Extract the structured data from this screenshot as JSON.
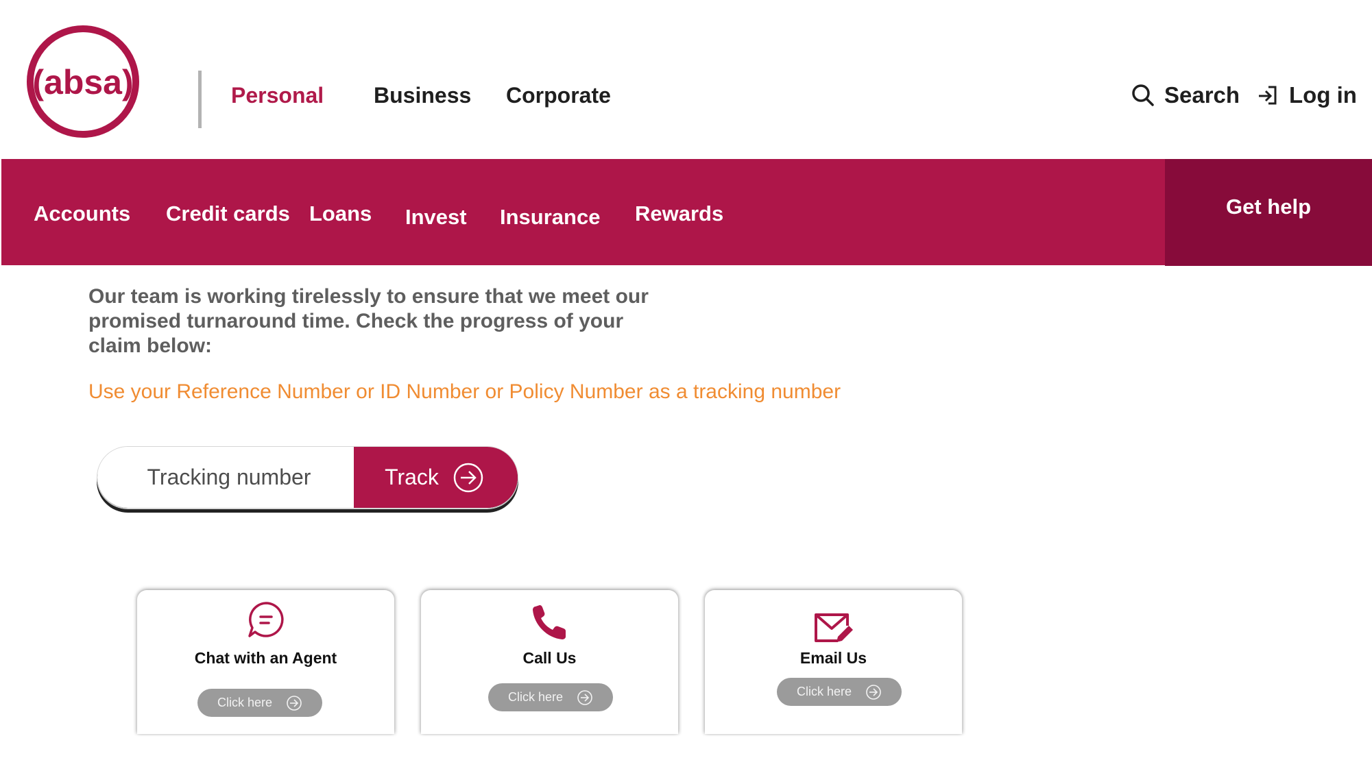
{
  "brand": {
    "logo_text": "absa",
    "accent": "#ae1649",
    "accent_dark": "#870b3a",
    "hint_color": "#f08c32"
  },
  "segments": [
    "Personal",
    "Business",
    "Corporate"
  ],
  "utility": {
    "search_label": "Search",
    "login_label": "Log in"
  },
  "nav": {
    "items": [
      "Accounts",
      "Credit cards",
      "Loans",
      "Invest",
      "Insurance",
      "Rewards"
    ],
    "get_help": "Get help"
  },
  "main": {
    "intro": "Our  team is working tirelessly to ensure that we meet our\npromised turnaround time. Check the progress of your\nclaim below:",
    "hint": "Use your Reference Number or ID Number or Policy Number as a tracking number",
    "tracking_placeholder": "Tracking number",
    "track_label": "Track"
  },
  "cards": [
    {
      "title": "Chat with an Agent",
      "button": "Click here",
      "icon": "chat-icon"
    },
    {
      "title": "Call Us",
      "button": "Click here",
      "icon": "phone-icon"
    },
    {
      "title": "Email Us",
      "button": "Click here",
      "icon": "email-icon"
    }
  ]
}
